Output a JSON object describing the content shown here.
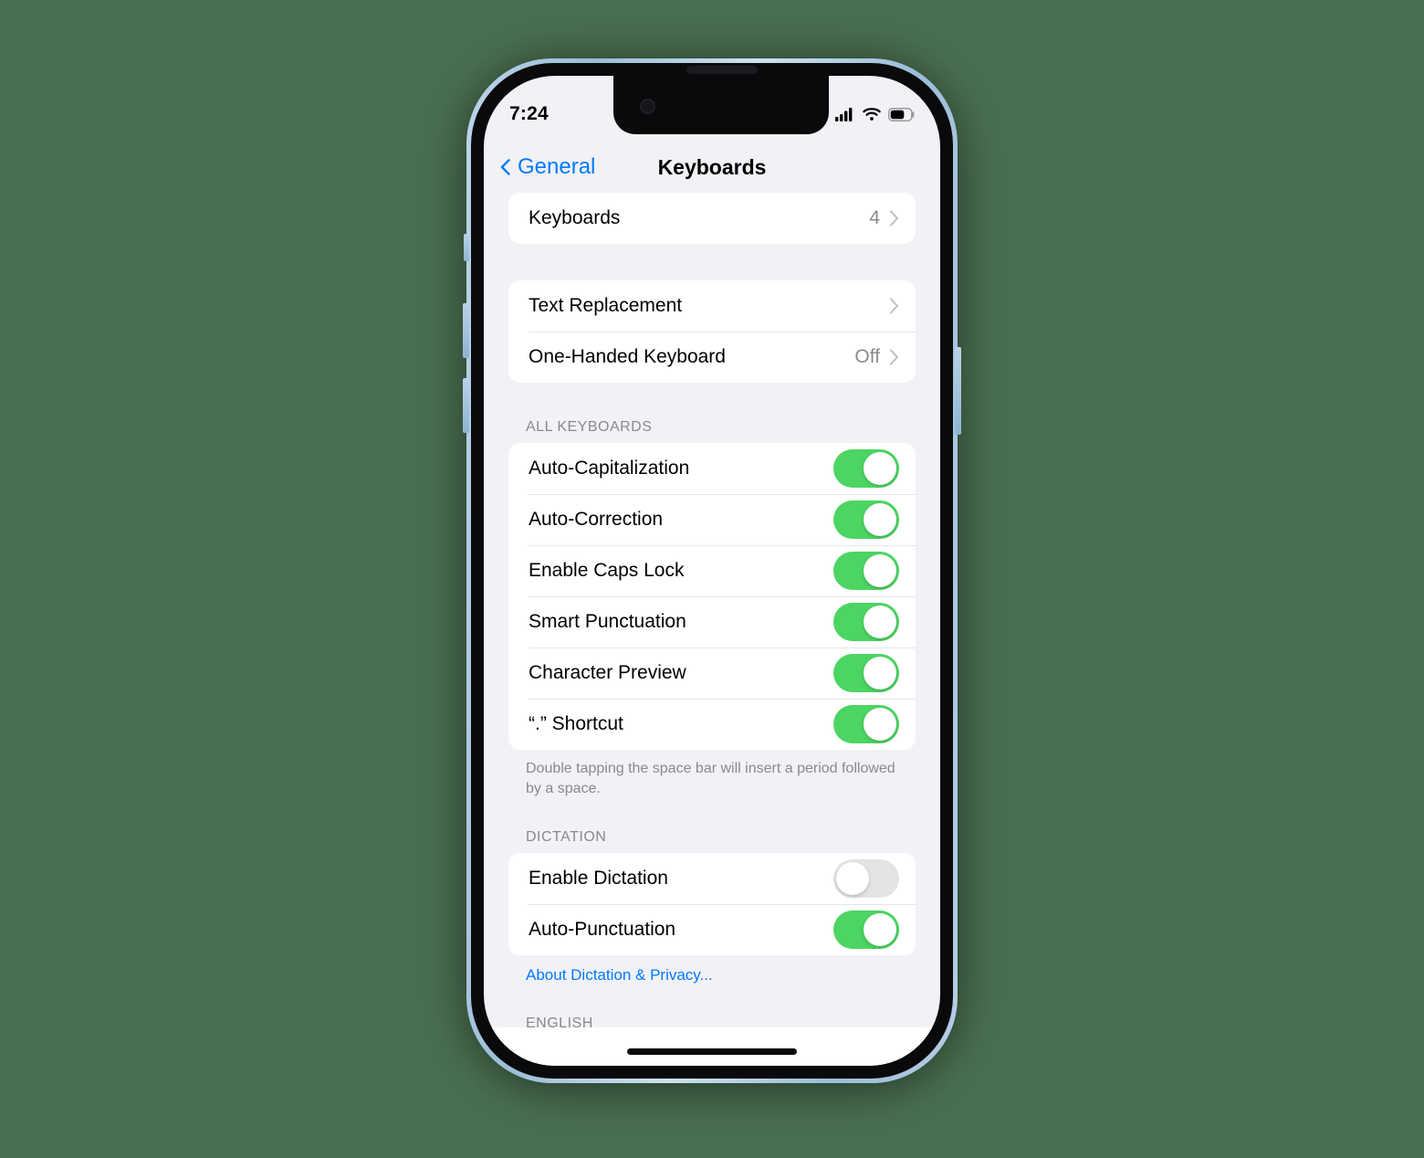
{
  "status_bar": {
    "time": "7:24",
    "cellular_icon": "cellular-signal-icon",
    "wifi_icon": "wifi-icon",
    "battery_icon": "battery-icon"
  },
  "nav": {
    "back_label": "General",
    "back_icon": "chevron-left-icon",
    "title": "Keyboards"
  },
  "colors": {
    "accent_blue": "#007AFF",
    "toggle_on_green": "#4CD562",
    "toggle_off_gray": "#E4E4E6",
    "screen_background": "#F2F1F6",
    "card_background": "#FFFFFF",
    "secondary_text": "#8A8A8E",
    "page_background": "#4A6F50"
  },
  "sections": [
    {
      "header": "",
      "rows": [
        {
          "label": "Keyboards",
          "value": "4",
          "type": "disclosure",
          "icon": "chevron-right-icon"
        }
      ]
    },
    {
      "header": "",
      "rows": [
        {
          "label": "Text Replacement",
          "value": "",
          "type": "disclosure",
          "icon": "chevron-right-icon"
        },
        {
          "label": "One-Handed Keyboard",
          "value": "Off",
          "type": "disclosure",
          "icon": "chevron-right-icon"
        }
      ]
    },
    {
      "header": "ALL KEYBOARDS",
      "rows": [
        {
          "label": "Auto-Capitalization",
          "type": "toggle",
          "state": "on"
        },
        {
          "label": "Auto-Correction",
          "type": "toggle",
          "state": "on"
        },
        {
          "label": "Enable Caps Lock",
          "type": "toggle",
          "state": "on"
        },
        {
          "label": "Smart Punctuation",
          "type": "toggle",
          "state": "on"
        },
        {
          "label": "Character Preview",
          "type": "toggle",
          "state": "on"
        },
        {
          "label": "“.” Shortcut",
          "type": "toggle",
          "state": "on"
        }
      ],
      "footnote": "Double tapping the space bar will insert a period followed by a space."
    },
    {
      "header": "DICTATION",
      "rows": [
        {
          "label": "Enable Dictation",
          "type": "toggle",
          "state": "off"
        },
        {
          "label": "Auto-Punctuation",
          "type": "toggle",
          "state": "on"
        }
      ],
      "link": "About Dictation & Privacy..."
    },
    {
      "header": "ENGLISH",
      "rows": []
    }
  ]
}
